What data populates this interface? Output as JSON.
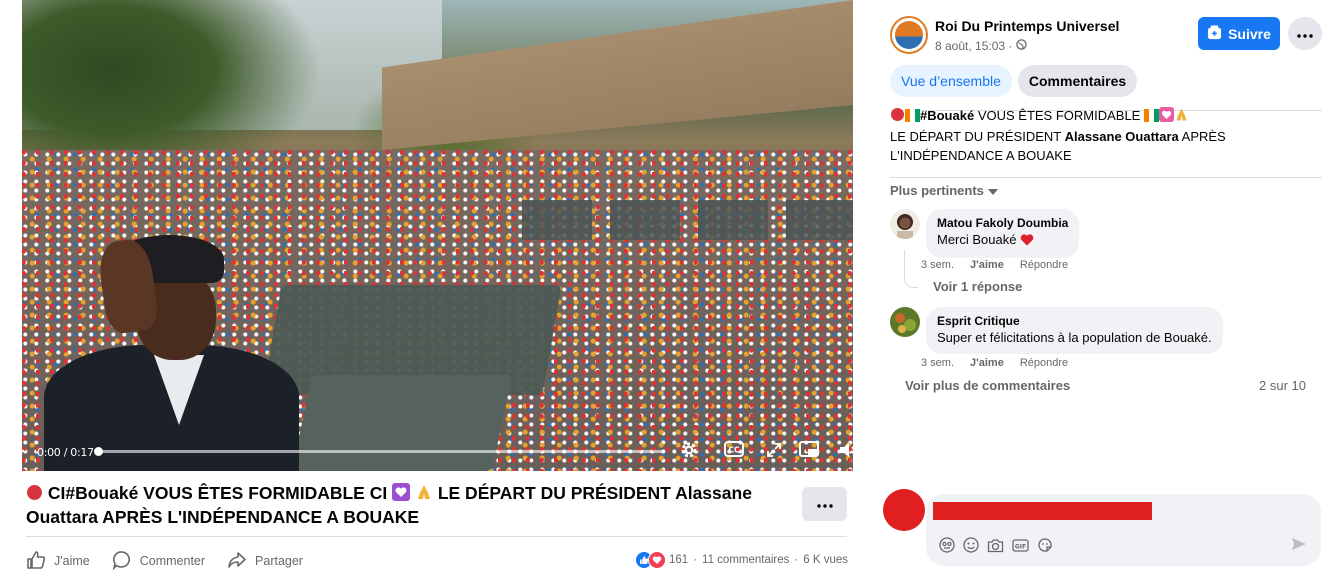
{
  "video": {
    "time": "0:00 / 0:17",
    "progress": 0
  },
  "post": {
    "title_prefix": " CI#Bouaké VOUS ÊTES FORMIDABLE CI",
    "title_suffix": " LE DÉPART DU PRÉSIDENT Alassane Ouattara APRÈS L'INDÉPENDANCE A BOUAKE",
    "actions": {
      "like": "J'aime",
      "comment": "Commenter",
      "share": "Partager"
    },
    "stats": {
      "reactions": "161",
      "comments": "11 commentaires",
      "views": "6 K vues",
      "separator": "·"
    }
  },
  "sidebar": {
    "page_name": "Roi Du Printemps Universel",
    "date": "8 août, 15:03 ·",
    "follow_label": "Suivre",
    "tabs": {
      "overview": "Vue d’ensemble",
      "comments": "Commentaires"
    },
    "caption": {
      "line1_tag": "#Bouaké",
      "line1_rest": " VOUS ÊTES FORMIDABLE ",
      "line2_a": "LE DÉPART DU PRÉSIDENT ",
      "line2_name": "Alassane Ouattara",
      "line2_b": " APRÈS",
      "line3": "L'INDÉPENDANCE A BOUAKE"
    },
    "sort_label": "Plus pertinents",
    "comments": [
      {
        "author": "Matou Fakoly Doumbia",
        "text": "Merci Bouaké",
        "time": "3 sem.",
        "like": "J'aime",
        "reply": "Répondre"
      },
      {
        "author": "Esprit Critique",
        "text": "Super et félicitations à la population de Bouaké.",
        "time": "3 sem.",
        "like": "J'aime",
        "reply": "Répondre"
      }
    ],
    "view_reply": "Voir 1 réponse",
    "more_comments": "Voir plus de commentaires",
    "count": "2 sur 10"
  },
  "colors": {
    "accent": "#1877f2",
    "love": "#f33e58",
    "redaction": "#e02020"
  }
}
